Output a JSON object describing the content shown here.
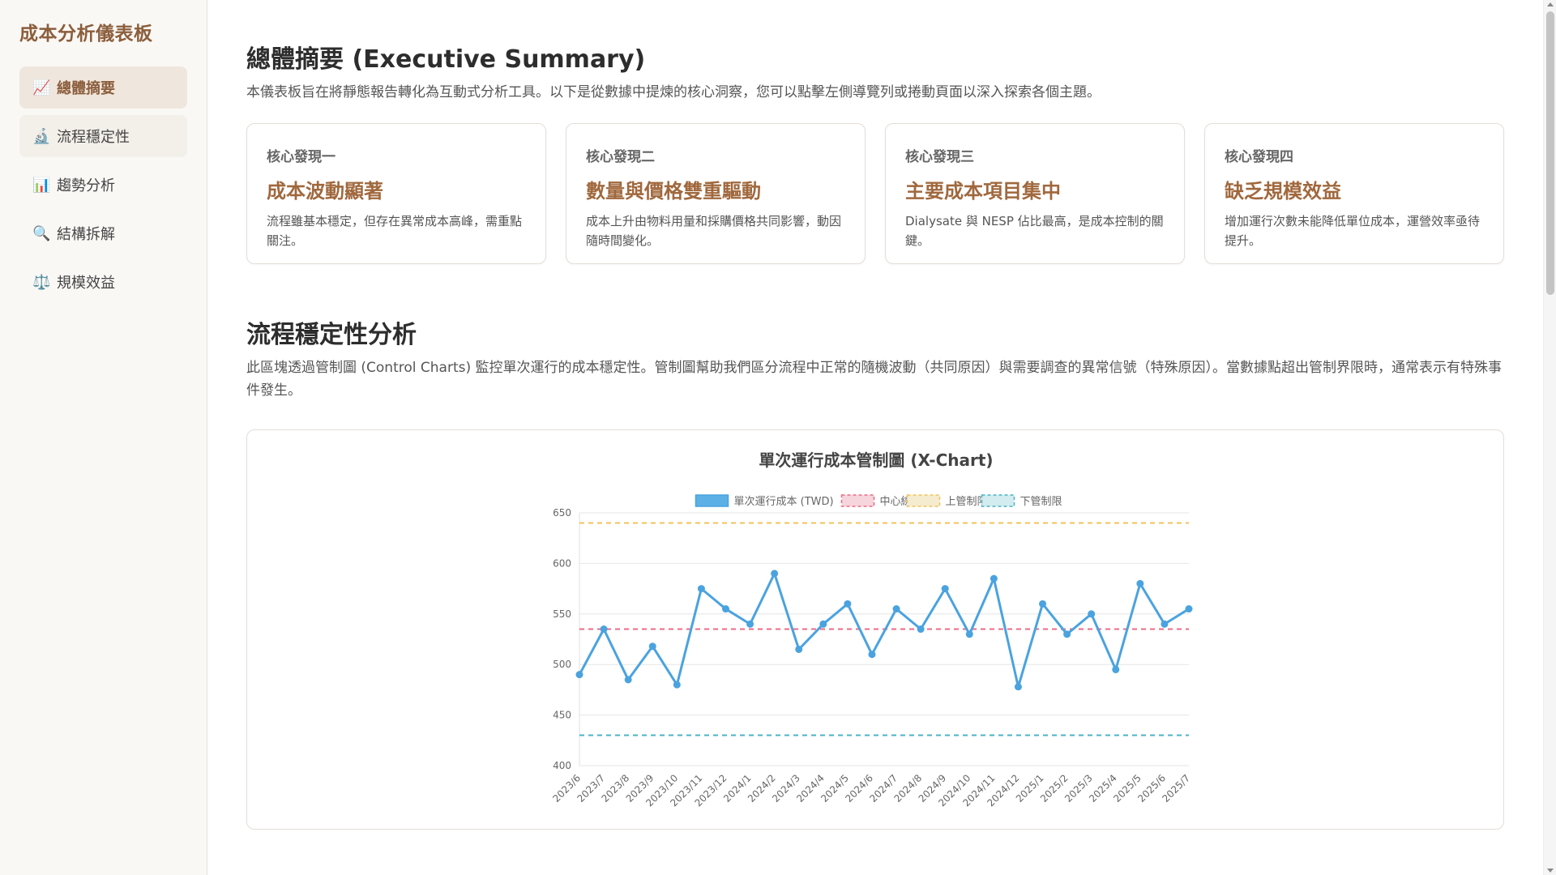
{
  "sidebar": {
    "title": "成本分析儀表板",
    "items": [
      {
        "icon": "📈",
        "icon_name": "chart-increasing-icon",
        "label": "總體摘要",
        "active": true
      },
      {
        "icon": "🔬",
        "icon_name": "microscope-icon",
        "label": "流程穩定性"
      },
      {
        "icon": "📊",
        "icon_name": "bar-chart-icon",
        "label": "趨勢分析"
      },
      {
        "icon": "🔍",
        "icon_name": "magnifier-icon",
        "label": "結構拆解"
      },
      {
        "icon": "⚖️",
        "icon_name": "balance-scale-icon",
        "label": "規模效益"
      }
    ]
  },
  "summary": {
    "title": "總體摘要 (Executive Summary)",
    "description": "本儀表板旨在將靜態報告轉化為互動式分析工具。以下是從數據中提煉的核心洞察，您可以點擊左側導覽列或捲動頁面以深入探索各個主題。",
    "cards": [
      {
        "kicker": "核心發現一",
        "heading": "成本波動顯著",
        "text": "流程雖基本穩定，但存在異常成本高峰，需重點關注。"
      },
      {
        "kicker": "核心發現二",
        "heading": "數量與價格雙重驅動",
        "text": "成本上升由物料用量和採購價格共同影響，動因隨時間變化。"
      },
      {
        "kicker": "核心發現三",
        "heading": "主要成本項目集中",
        "text": "Dialysate 與 NESP 佔比最高，是成本控制的關鍵。"
      },
      {
        "kicker": "核心發現四",
        "heading": "缺乏規模效益",
        "text": "增加運行次數未能降低單位成本，運營效率亟待提升。"
      }
    ]
  },
  "stability": {
    "title": "流程穩定性分析",
    "description": "此區塊透過管制圖 (Control Charts) 監控單次運行的成本穩定性。管制圖幫助我們區分流程中正常的隨機波動（共同原因）與需要調查的異常信號（特殊原因）。當數據點超出管制界限時，通常表示有特殊事件發生。"
  },
  "colors": {
    "accent": "#8b5e3c",
    "series": "#4aa3df",
    "center": "#ee6a86",
    "ucl": "#f2c35a",
    "lcl": "#4bb3c6"
  },
  "chart_data": {
    "type": "line",
    "title": "單次運行成本管制圖 (X-Chart)",
    "legend_position": "top-center",
    "grid": true,
    "categories": [
      "2023/6",
      "2023/7",
      "2023/8",
      "2023/9",
      "2023/10",
      "2023/11",
      "2023/12",
      "2024/1",
      "2024/2",
      "2024/3",
      "2024/4",
      "2024/5",
      "2024/6",
      "2024/7",
      "2024/8",
      "2024/9",
      "2024/10",
      "2024/11",
      "2024/12",
      "2025/1",
      "2025/2",
      "2025/3",
      "2025/4",
      "2025/5",
      "2025/6",
      "2025/7"
    ],
    "ylim": [
      400,
      650
    ],
    "yticks": [
      400,
      450,
      500,
      550,
      600,
      650
    ],
    "series": [
      {
        "name": "單次運行成本 (TWD)",
        "values": [
          490,
          535,
          485,
          518,
          480,
          575,
          555,
          540,
          590,
          515,
          540,
          560,
          510,
          555,
          535,
          575,
          530,
          585,
          478,
          560,
          530,
          550,
          495,
          580,
          540,
          555
        ]
      },
      {
        "name": "中心線",
        "constant": 535
      },
      {
        "name": "上管制限",
        "constant": 640
      },
      {
        "name": "下管制限",
        "constant": 430
      }
    ]
  }
}
